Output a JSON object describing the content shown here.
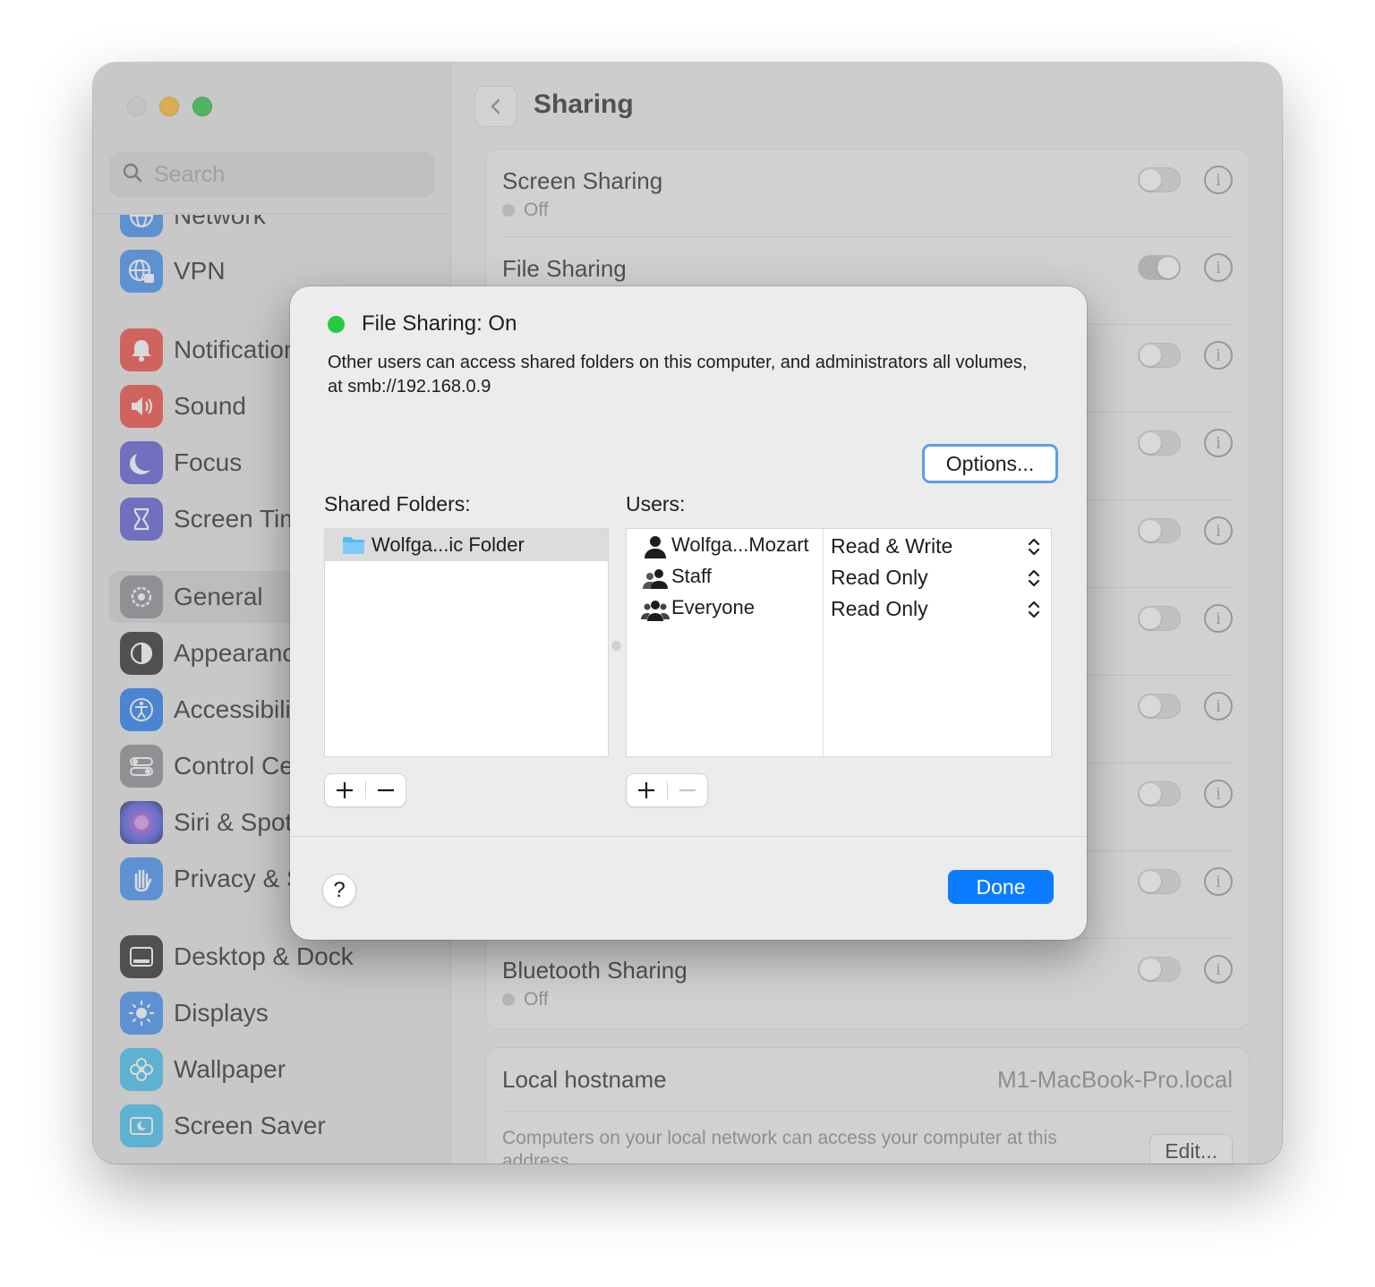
{
  "window": {
    "title": "Sharing"
  },
  "sidebar": {
    "search_placeholder": "Search",
    "items": [
      {
        "label": "Network",
        "color": "#3d8ff5"
      },
      {
        "label": "VPN",
        "color": "#3d8ff5"
      },
      {
        "label": "Notifications",
        "color": "#f2473f"
      },
      {
        "label": "Sound",
        "color": "#f2473f"
      },
      {
        "label": "Focus",
        "color": "#5b5bd6"
      },
      {
        "label": "Screen Time",
        "color": "#5b5bd6"
      },
      {
        "label": "General",
        "color": "#8e8e93",
        "selected": true
      },
      {
        "label": "Appearance",
        "color": "#1d1d1f"
      },
      {
        "label": "Accessibility",
        "color": "#1e7cf2"
      },
      {
        "label": "Control Centre",
        "color": "#8e8e93"
      },
      {
        "label": "Siri & Spotlight",
        "color": "#a045d6"
      },
      {
        "label": "Privacy & Security",
        "color": "#3d8ff5"
      },
      {
        "label": "Desktop & Dock",
        "color": "#1d1d1f"
      },
      {
        "label": "Displays",
        "color": "#3d8ff5"
      },
      {
        "label": "Wallpaper",
        "color": "#3ec1f2"
      },
      {
        "label": "Screen Saver",
        "color": "#3ec1f2"
      }
    ]
  },
  "main": {
    "title": "Sharing",
    "services": [
      {
        "name": "Screen Sharing",
        "status": "Off",
        "enabled": false
      },
      {
        "name": "File Sharing",
        "status": "",
        "enabled": true
      },
      {
        "name": "",
        "status": "",
        "enabled": false
      },
      {
        "name": "",
        "status": "",
        "enabled": false
      },
      {
        "name": "",
        "status": "",
        "enabled": false
      },
      {
        "name": "",
        "status": "",
        "enabled": false
      },
      {
        "name": "",
        "status": "",
        "enabled": false
      },
      {
        "name": "",
        "status": "",
        "enabled": false
      },
      {
        "name": "",
        "status": "",
        "enabled": false
      },
      {
        "name": "Bluetooth Sharing",
        "status": "Off",
        "enabled": false
      }
    ],
    "hostname": {
      "label": "Local hostname",
      "value": "M1-MacBook-Pro.local",
      "description": "Computers on your local network can access your computer at this address.",
      "edit_label": "Edit..."
    }
  },
  "dialog": {
    "title": "File Sharing: On",
    "description": "Other users can access shared folders on this computer, and administrators all volumes, at smb://192.168.0.9",
    "options_label": "Options...",
    "shared_folders_label": "Shared Folders:",
    "users_label": "Users:",
    "folders": [
      {
        "name": "Wolfga...ic Folder"
      }
    ],
    "users": [
      {
        "name": "Wolfga...Mozart",
        "permission": "Read & Write",
        "icon": "single-user-icon"
      },
      {
        "name": "Staff",
        "permission": "Read Only",
        "icon": "group-icon"
      },
      {
        "name": "Everyone",
        "permission": "Read Only",
        "icon": "everyone-icon"
      }
    ],
    "help_label": "?",
    "done_label": "Done",
    "accent_color": "#0a7cff",
    "status_color": "#28c840"
  }
}
